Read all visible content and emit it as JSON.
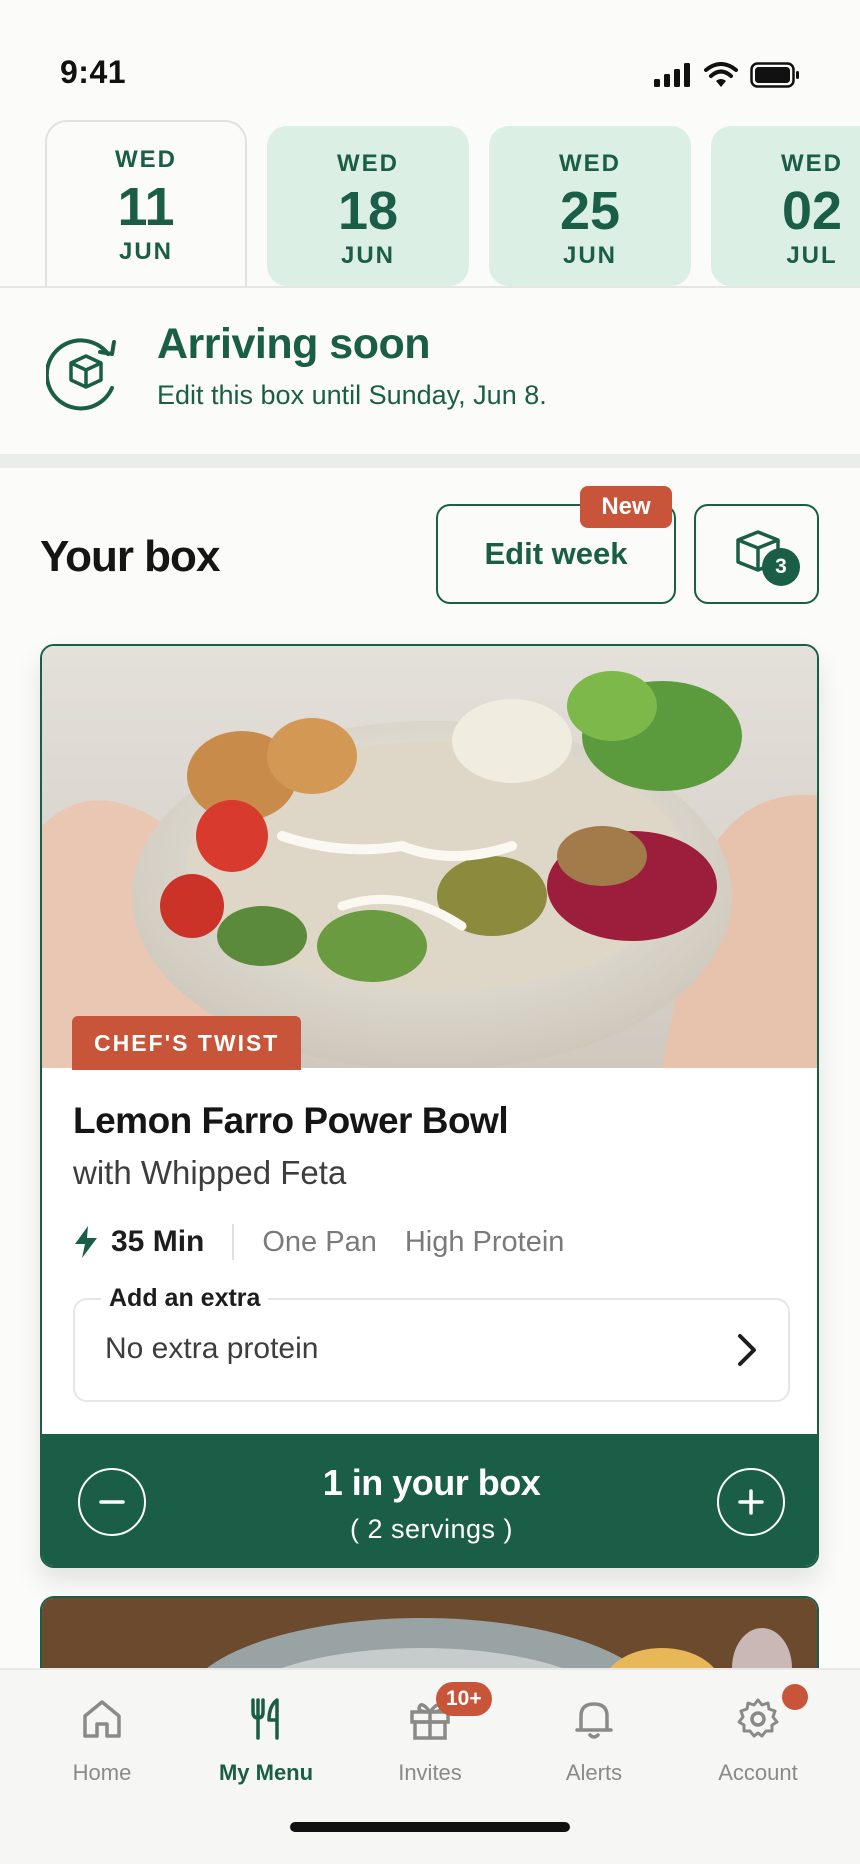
{
  "status": {
    "time": "9:41"
  },
  "dates": [
    {
      "dow": "WED",
      "day": "11",
      "mon": "JUN"
    },
    {
      "dow": "WED",
      "day": "18",
      "mon": "JUN"
    },
    {
      "dow": "WED",
      "day": "25",
      "mon": "JUN"
    },
    {
      "dow": "WED",
      "day": "02",
      "mon": "JUL"
    }
  ],
  "arriving": {
    "title": "Arriving soon",
    "subtitle": "Edit this box until Sunday, Jun 8."
  },
  "box": {
    "title": "Your box",
    "edit_week_label": "Edit week",
    "new_badge": "New",
    "count": "3"
  },
  "recipe": {
    "tag": "CHEF'S TWIST",
    "name": "Lemon Farro Power Bowl",
    "subtitle": "with Whipped Feta",
    "time": "35 Min",
    "tags": [
      "One Pan",
      "High Protein"
    ],
    "extra_label": "Add an extra",
    "extra_value": "No extra protein",
    "in_box": "1 in your box",
    "servings": "( 2 servings )"
  },
  "nav": {
    "items": [
      {
        "label": "Home"
      },
      {
        "label": "My Menu"
      },
      {
        "label": "Invites"
      },
      {
        "label": "Alerts"
      },
      {
        "label": "Account"
      }
    ],
    "invites_badge": "10+"
  },
  "colors": {
    "brand_green": "#1a5e48",
    "accent_orange": "#c8553a",
    "tab_bg": "#dcefe5"
  }
}
